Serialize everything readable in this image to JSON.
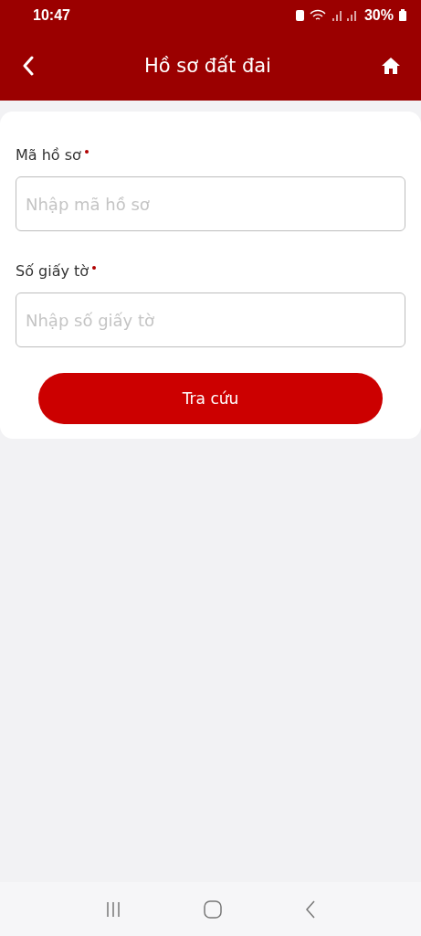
{
  "status_bar": {
    "time": "10:47",
    "battery": "30%"
  },
  "header": {
    "title": "Hồ sơ đất đai"
  },
  "form": {
    "fields": [
      {
        "label": "Mã hồ sơ",
        "required": true,
        "placeholder": "Nhập mã hồ sơ"
      },
      {
        "label": "Số giấy tờ",
        "required": true,
        "placeholder": "Nhập số giấy tờ"
      }
    ],
    "submit": "Tra cứu"
  }
}
